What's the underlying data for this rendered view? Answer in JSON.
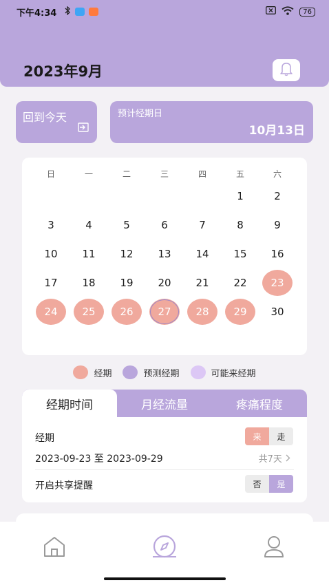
{
  "status_bar": {
    "time": "下午4:34",
    "battery": "76"
  },
  "header": {
    "title": "2023年9月"
  },
  "today_card": {
    "label": "回到今天"
  },
  "predict_card": {
    "label": "预计经期日",
    "value": "10月13日"
  },
  "calendar": {
    "weekdays": [
      "日",
      "一",
      "二",
      "三",
      "四",
      "五",
      "六"
    ],
    "rows": [
      [
        "",
        "",
        "",
        "",
        "",
        "1",
        "2"
      ],
      [
        "3",
        "4",
        "5",
        "6",
        "7",
        "8",
        "9"
      ],
      [
        "10",
        "11",
        "12",
        "13",
        "14",
        "15",
        "16"
      ],
      [
        "17",
        "18",
        "19",
        "20",
        "21",
        "22",
        "23"
      ],
      [
        "24",
        "25",
        "26",
        "27",
        "28",
        "29",
        "30"
      ]
    ],
    "period_days": [
      "23",
      "24",
      "25",
      "26",
      "27",
      "28",
      "29"
    ],
    "today": "27"
  },
  "legend": [
    {
      "label": "经期",
      "color": "#f0a99d"
    },
    {
      "label": "预测经期",
      "color": "#b9a6dc"
    },
    {
      "label": "可能来经期",
      "color": "#dcc7f5"
    }
  ],
  "panel": {
    "tabs": [
      "经期时间",
      "月经流量",
      "疼痛程度"
    ],
    "active_tab": "经期时间",
    "period_label": "经期",
    "come_label": "来",
    "leave_label": "走",
    "date_range": "2023-09-23 至 2023-09-29",
    "days_total": "共7天",
    "share_label": "开启共享提醒",
    "no_label": "否",
    "yes_label": "是"
  },
  "colors": {
    "accent": "#b9a6dc",
    "period": "#f0a99d",
    "possible": "#dcc7f5"
  },
  "navbar": {
    "items": [
      "home-icon",
      "compass-icon",
      "profile-icon"
    ],
    "active": "compass-icon"
  }
}
